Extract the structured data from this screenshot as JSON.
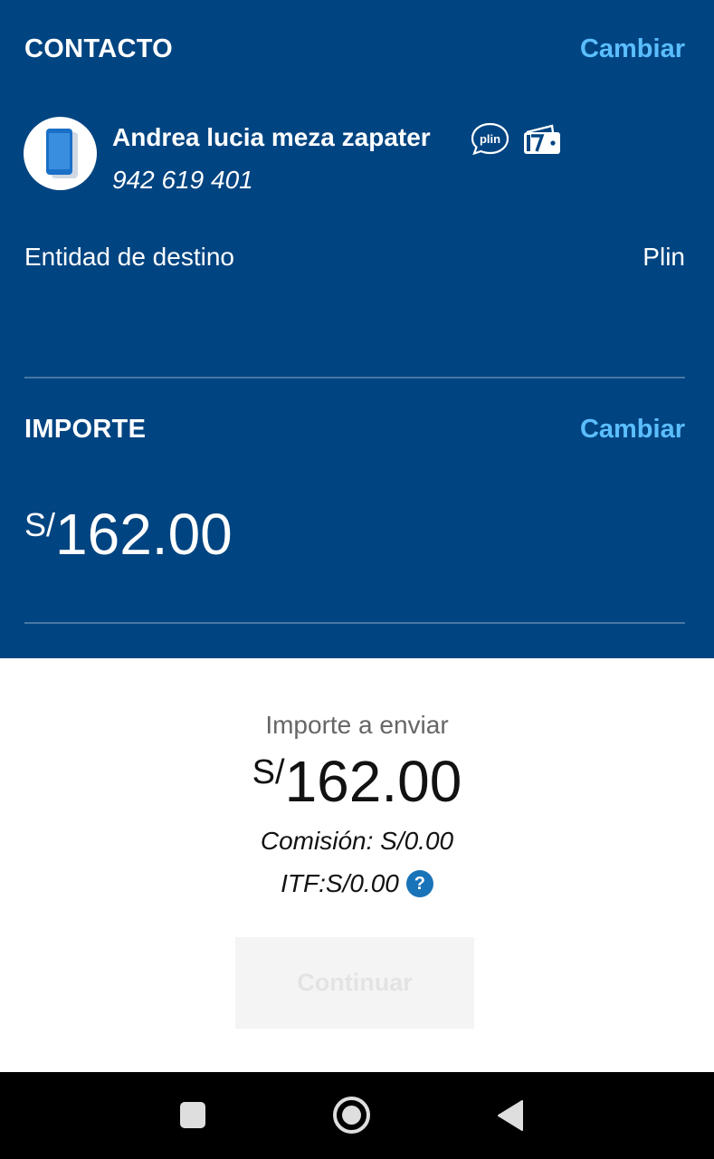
{
  "contact": {
    "title": "CONTACTO",
    "change_label": "Cambiar",
    "name": "Andrea lucia meza zapater",
    "plin_badge_text": "plin",
    "phone": "942 619 401",
    "destination_label": "Entidad de destino",
    "destination_value": "Plin"
  },
  "amount": {
    "title": "IMPORTE",
    "change_label": "Cambiar",
    "currency": "S/",
    "value": "162.00"
  },
  "summary": {
    "label": "Importe a enviar",
    "currency": "S/",
    "value": "162.00",
    "fee_text": "Comisión: S/0.00",
    "itf_text": "ITF:S/0.00",
    "help_symbol": "?"
  },
  "actions": {
    "continue_label": "Continuar"
  },
  "icons": {
    "avatar": "phone-icon",
    "badges": [
      "plin-icon",
      "wallet-icon"
    ],
    "nav": [
      "recents-icon",
      "home-icon",
      "back-icon"
    ]
  },
  "colors": {
    "header_bg": "#004481",
    "link": "#5bbeff",
    "help_icon": "#1973b8",
    "button_disabled_bg": "#f4f4f4"
  }
}
